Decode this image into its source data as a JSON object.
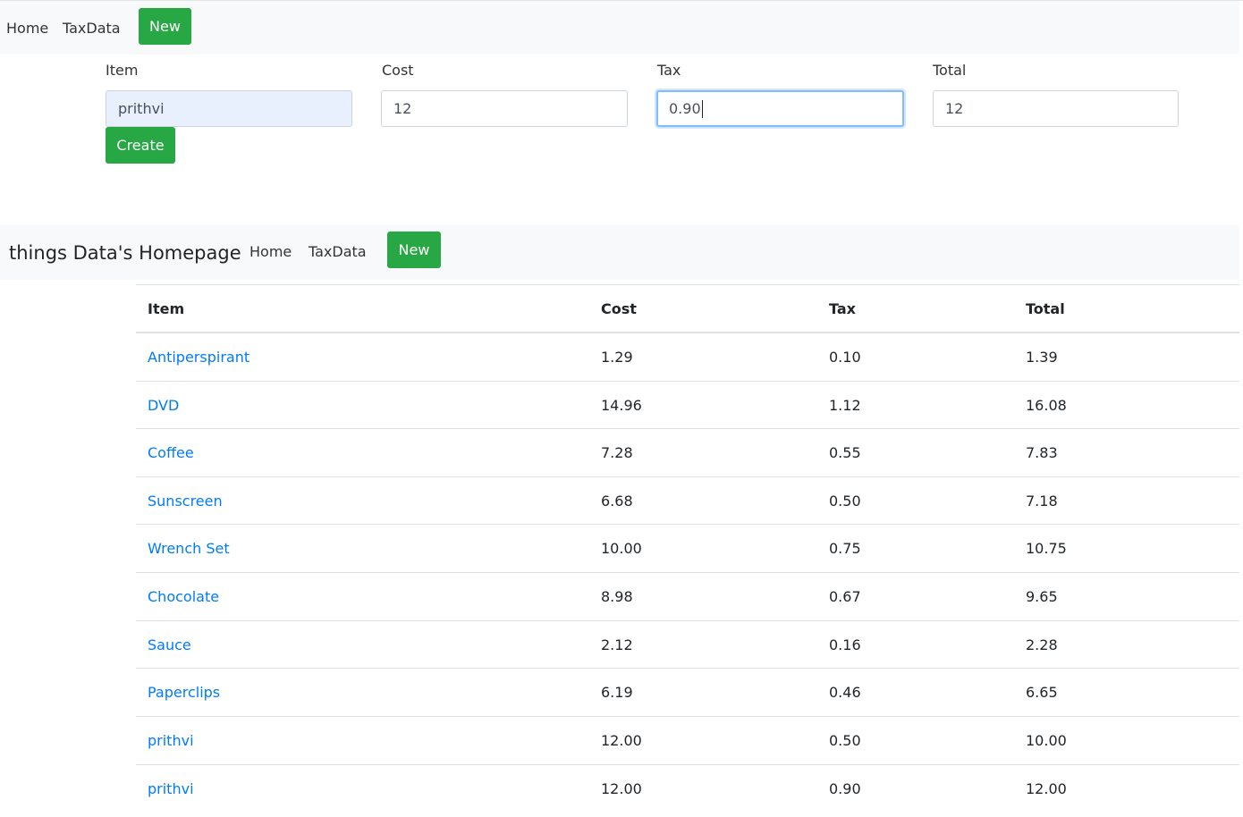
{
  "top_nav": {
    "home": "Home",
    "taxdata": "TaxData",
    "new_button": "New"
  },
  "form": {
    "item_label": "Item",
    "item_value": "prithvi",
    "cost_label": "Cost",
    "cost_value": "12",
    "tax_label": "Tax",
    "tax_value": "0.90",
    "total_label": "Total",
    "total_value": "12",
    "create_button": "Create"
  },
  "second_nav": {
    "brand": "things Data's Homepage",
    "home": "Home",
    "taxdata": "TaxData",
    "new_button": "New"
  },
  "table": {
    "headers": [
      "Item",
      "Cost",
      "Tax",
      "Total"
    ],
    "rows": [
      {
        "item": "Antiperspirant",
        "cost": "1.29",
        "tax": "0.10",
        "total": "1.39"
      },
      {
        "item": "DVD",
        "cost": "14.96",
        "tax": "1.12",
        "total": "16.08"
      },
      {
        "item": "Coffee",
        "cost": "7.28",
        "tax": "0.55",
        "total": "7.83"
      },
      {
        "item": "Sunscreen",
        "cost": "6.68",
        "tax": "0.50",
        "total": "7.18"
      },
      {
        "item": "Wrench Set",
        "cost": "10.00",
        "tax": "0.75",
        "total": "10.75"
      },
      {
        "item": "Chocolate",
        "cost": "8.98",
        "tax": "0.67",
        "total": "9.65"
      },
      {
        "item": "Sauce",
        "cost": "2.12",
        "tax": "0.16",
        "total": "2.28"
      },
      {
        "item": "Paperclips",
        "cost": "6.19",
        "tax": "0.46",
        "total": "6.65"
      },
      {
        "item": "prithvi",
        "cost": "12.00",
        "tax": "0.50",
        "total": "10.00"
      },
      {
        "item": "prithvi",
        "cost": "12.00",
        "tax": "0.90",
        "total": "12.00"
      }
    ]
  },
  "colors": {
    "accent_green": "#28a745",
    "link_blue": "#007bff",
    "navbar_bg": "#f8f9fa",
    "autofill_bg": "#e8f0fe",
    "focus_border": "#80bdff"
  }
}
